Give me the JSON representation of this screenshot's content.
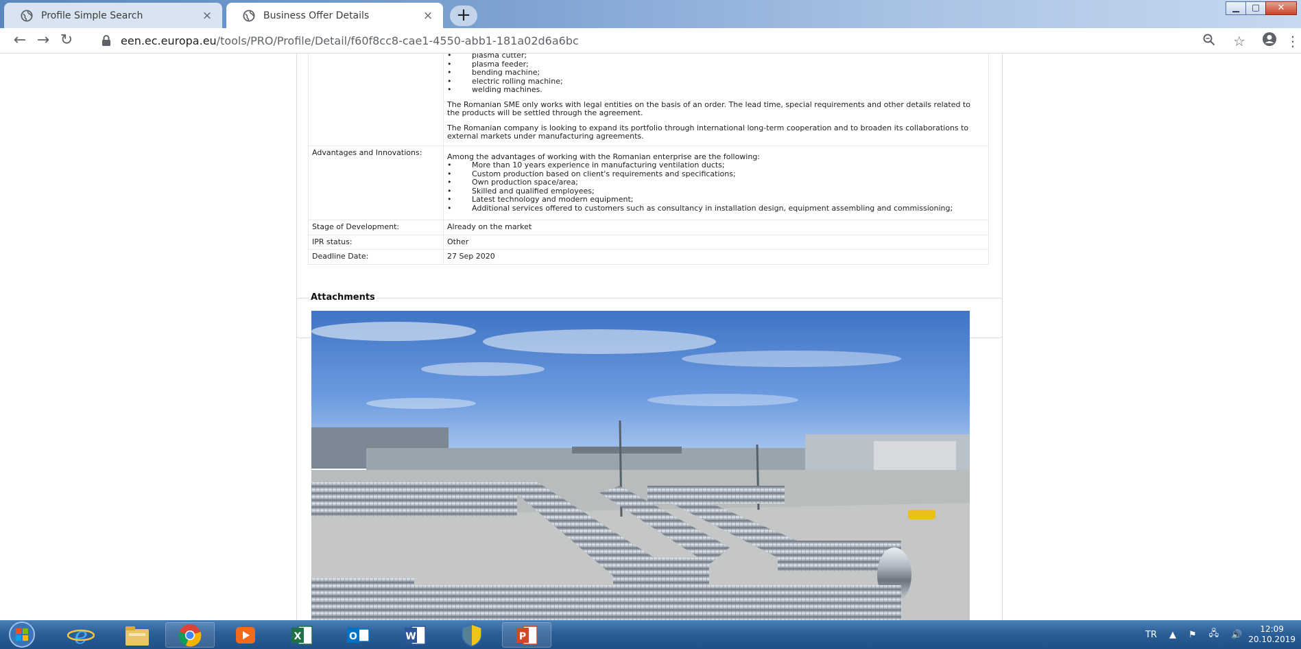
{
  "browser": {
    "tabs": [
      {
        "label": "Profile Simple Search",
        "active": false
      },
      {
        "label": "Business Offer Details",
        "active": true
      }
    ],
    "new_tab_symbol": "+",
    "close_symbol": "×",
    "url_host": "een.ec.europa.eu",
    "url_path": "/tools/PRO/Profile/Detail/f60f8cc8-cae1-4550-abb1-181a02d6a6bc",
    "icons": [
      "back-icon",
      "forward-icon",
      "reload-icon",
      "lock-icon",
      "zoom-icon",
      "star-icon",
      "profile-icon",
      "menu-icon"
    ]
  },
  "details": {
    "bullets_top": [
      "plasma cutter;",
      "plasma feeder;",
      "bending machine;",
      "electric rolling machine;",
      "welding machines."
    ],
    "para1": "The Romanian SME only works with legal entities on the basis of an order. The lead time, special requirements and other details related to the products will be settled through the agreement.",
    "para2": "The Romanian company is looking to expand its portfolio through international long-term cooperation and to broaden its collaborations to external markets under manufacturing agreements.",
    "advantages_label": "Advantages and Innovations:",
    "advantages_intro": "Among the advantages of working with the Romanian enterprise are the following:",
    "advantages": [
      "More than 10 years experience in manufacturing ventilation ducts;",
      "Custom production based on client's requirements and specifications;",
      "Own production space/area;",
      "Skilled and qualified employees;",
      "Latest technology and modern equipment;",
      "Additional services offered to customers such as consultancy in installation design, equipment assembling and commissioning;"
    ],
    "rows": [
      {
        "label": "Stage of Development:",
        "value": "Already on the market"
      },
      {
        "label": "IPR status:",
        "value": "Other"
      },
      {
        "label": "Deadline Date:",
        "value": "27 Sep 2020"
      }
    ]
  },
  "attachments": {
    "legend": "Attachments"
  },
  "taskbar": {
    "apps": [
      "start-orb",
      "internet-explorer-icon",
      "file-explorer-icon",
      "chrome-icon",
      "media-player-icon",
      "excel-icon",
      "outlook-icon",
      "word-icon",
      "security-center-icon",
      "powerpoint-icon"
    ],
    "language": "TR",
    "time": "12:09",
    "date": "20.10.2019"
  },
  "colors": {
    "taskbar": "#2c5f97",
    "tab_active": "#ffffff",
    "tab_inactive": "#d9e4f2"
  }
}
